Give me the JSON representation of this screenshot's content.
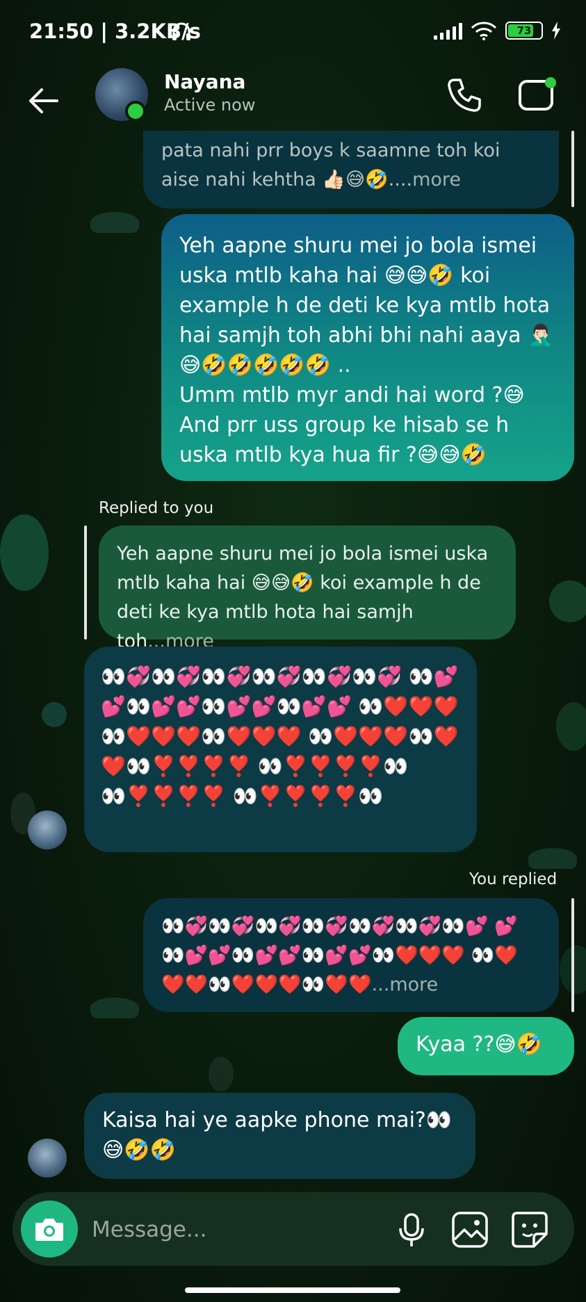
{
  "status_bar": {
    "time_speed": "21:50 | 3.2KB/s",
    "battery": "73"
  },
  "header": {
    "contact_name": "Nayana",
    "status": "Active now"
  },
  "messages": {
    "top_quote": {
      "text": "pata nahi prr boys k saamne toh koi aise nahi kehtha 👍🏻😅🤣....",
      "more": "more"
    },
    "sent_long": {
      "line1": "Yeh aapne shuru mei jo bola ismei uska mtlb kaha hai 😅😅🤣 koi example h de deti ke kya mtlb hota hai samjh toh abhi bhi nahi aaya 🤦🏻‍♂️ 😅🤣🤣🤣🤣🤣 ..",
      "line2": "Umm mtlb myr andi hai word ?😅",
      "line3": "And prr uss group ke hisab se h uska mtlb kya hua fir ?😅😅🤣"
    },
    "reply1": {
      "label": "Replied to you",
      "quote_text": "Yeh aapne shuru mei jo bola ismei uska mtlb kaha hai 😅😅🤣 koi example h de deti ke kya mtlb hota hai samjh toh",
      "more": "...more",
      "emoji_text": "👀💞👀💞👀💞👀💞👀💞👀💞 👀💕💕👀💕💕👀💕💕👀💕💕 👀❤️❤️❤️👀❤️❤️❤️👀❤️❤️❤️ 👀❤️❤️❤️👀❤️❤️👀❣️❣️❣️❣️ 👀❣️❣️❣️❣️👀👀❣️❣️❣️❣️ 👀❣️❣️❣️❣️👀"
    },
    "reply2": {
      "label": "You replied",
      "quote_text": "👀💞👀💞👀💞👀💞👀💞👀💞👀💕 💕👀💕💕👀💕💕👀💕💕👀❤️❤️❤️ 👀❤️❤️❤️👀❤️❤️❤️👀❤️❤️",
      "more": "...more"
    },
    "kyaa": "Kyaa ??😅🤣",
    "last": "Kaisa hai ye aapke phone mai?👀 😅🤣🤣"
  },
  "composer": {
    "placeholder": "Message..."
  },
  "colors": {
    "accent_green": "#1fb882",
    "received_bubble": "#0c3a45",
    "online": "#2ecc40"
  },
  "icons": [
    "back-arrow-icon",
    "phone-icon",
    "video-icon",
    "camera-icon",
    "mic-icon",
    "gallery-icon",
    "sticker-icon"
  ]
}
